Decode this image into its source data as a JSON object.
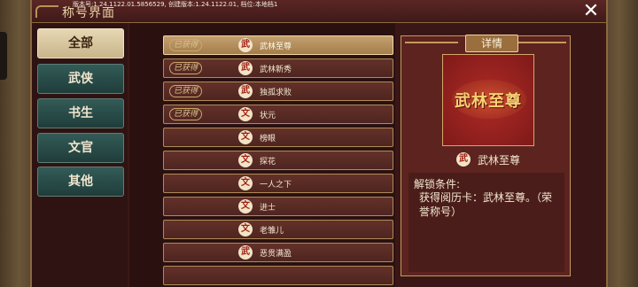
{
  "header": {
    "title": "称号界面",
    "version_text": "版本号:1.24.1122.01.5856529, 创建版本:1.24.1122.01, 档位:本地档1",
    "close_symbol": "✕"
  },
  "sidebar": {
    "tabs": [
      {
        "label": "全部",
        "active": true
      },
      {
        "label": "武侠",
        "active": false
      },
      {
        "label": "书生",
        "active": false
      },
      {
        "label": "文官",
        "active": false
      },
      {
        "label": "其他",
        "active": false
      }
    ]
  },
  "titles": [
    {
      "label": "武林至尊",
      "icon": "武",
      "badge": "已获得",
      "selected": true
    },
    {
      "label": "武林新秀",
      "icon": "武",
      "badge": "已获得",
      "selected": false
    },
    {
      "label": "独孤求败",
      "icon": "武",
      "badge": "已获得",
      "selected": false
    },
    {
      "label": "状元",
      "icon": "文",
      "badge": "已获得",
      "selected": false
    },
    {
      "label": "榜眼",
      "icon": "文",
      "badge": "",
      "selected": false
    },
    {
      "label": "探花",
      "icon": "文",
      "badge": "",
      "selected": false
    },
    {
      "label": "一人之下",
      "icon": "文",
      "badge": "",
      "selected": false
    },
    {
      "label": "进士",
      "icon": "文",
      "badge": "",
      "selected": false
    },
    {
      "label": "老雏儿",
      "icon": "文",
      "badge": "",
      "selected": false
    },
    {
      "label": "恶贯满盈",
      "icon": "武",
      "badge": "",
      "selected": false
    }
  ],
  "detail": {
    "header": "详情",
    "preview_text": "武林至尊",
    "icon": "武",
    "name": "武林至尊",
    "unlock_label": "解锁条件:",
    "unlock_text": "获得阅历卡：武林至尊。（荣誉称号）"
  }
}
